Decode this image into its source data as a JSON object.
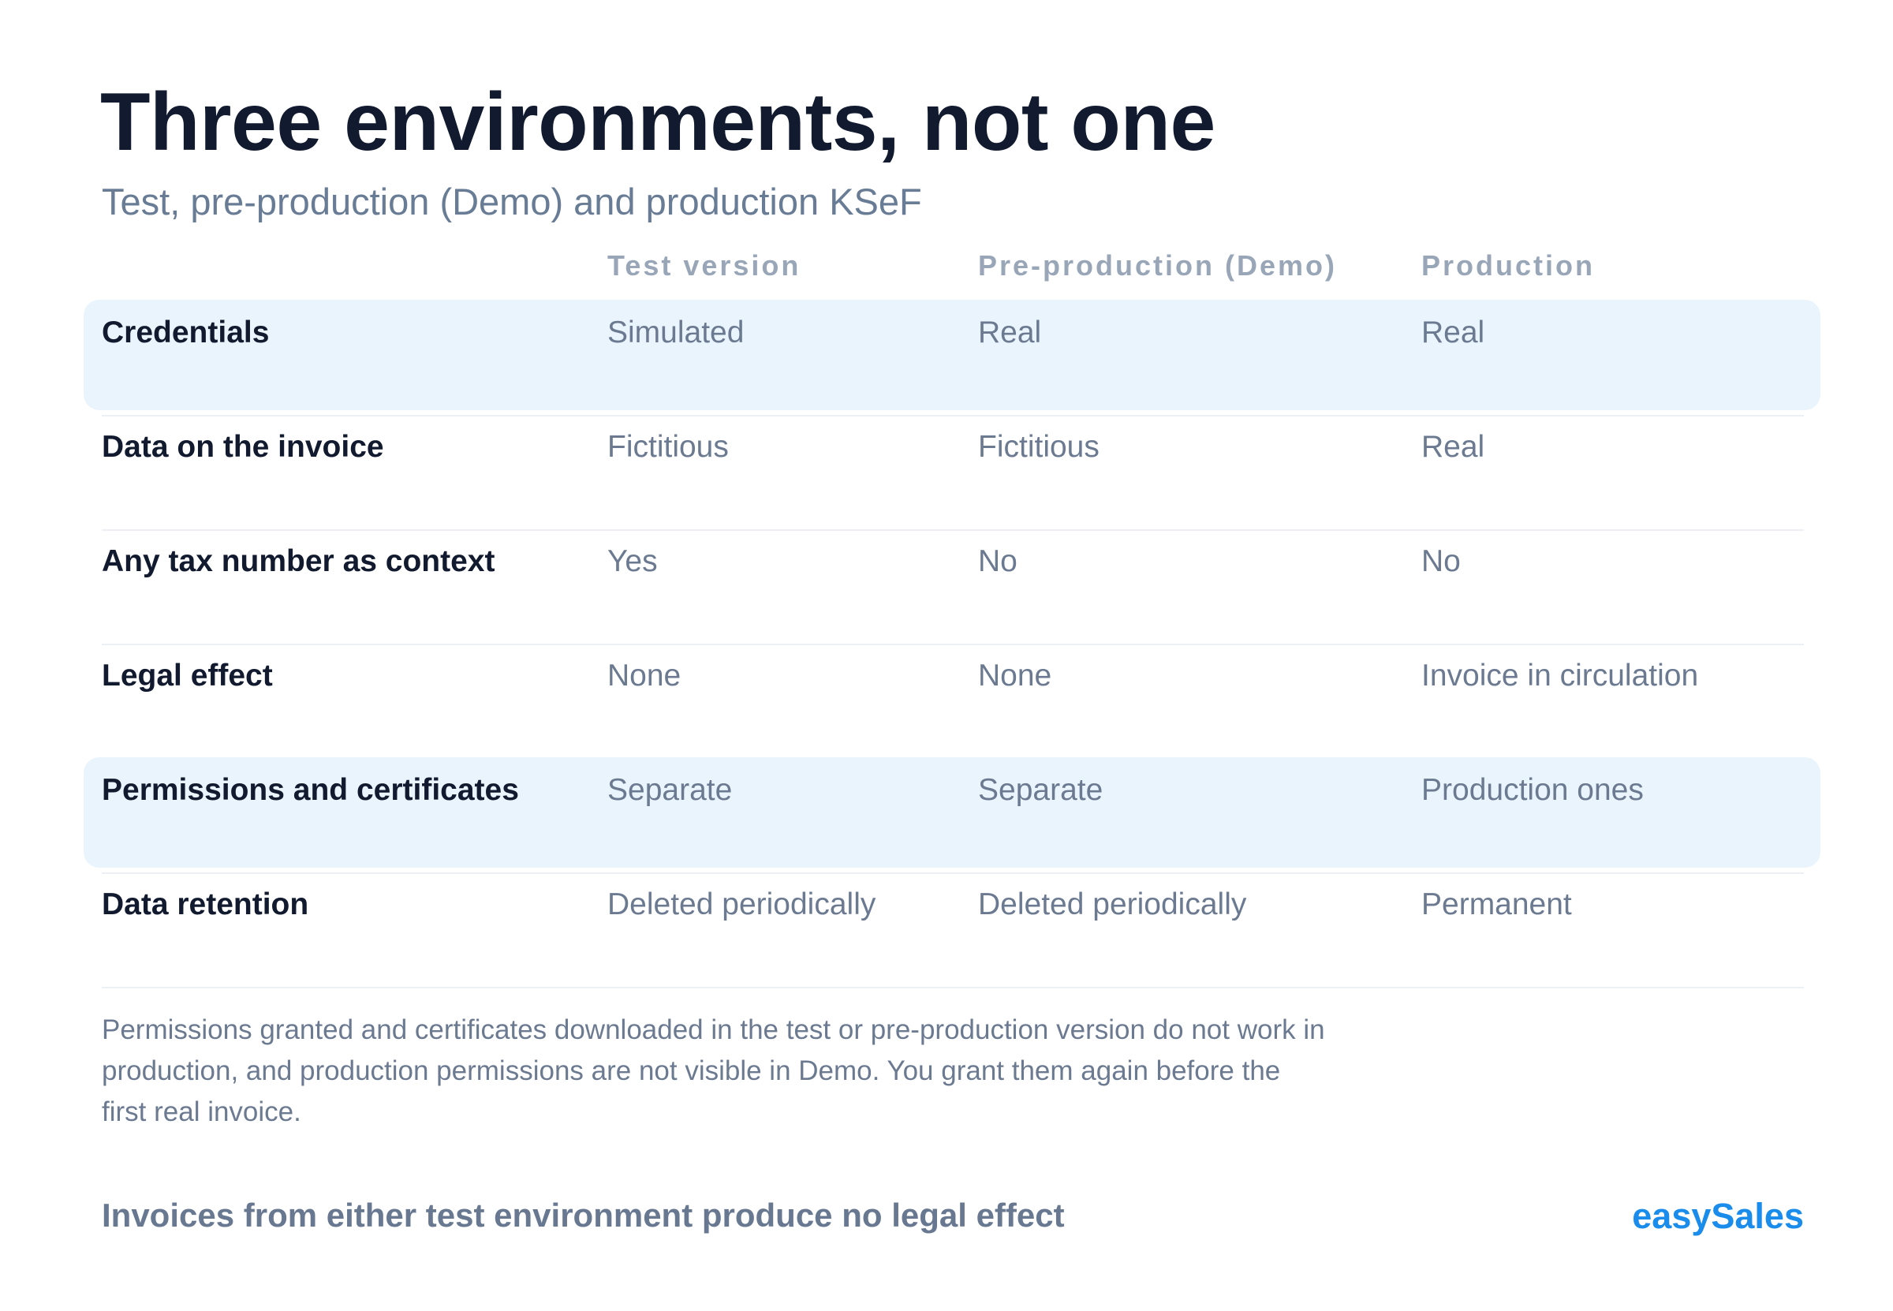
{
  "header": {
    "title": "Three environments, not one",
    "subtitle": "Test, pre-production (Demo) and production KSeF"
  },
  "table": {
    "columns": [
      "Test version",
      "Pre-production (Demo)",
      "Production"
    ],
    "rows": [
      {
        "label": "Credentials",
        "values": [
          "Simulated",
          "Real",
          "Real"
        ],
        "highlighted": true
      },
      {
        "label": "Data on the invoice",
        "values": [
          "Fictitious",
          "Fictitious",
          "Real"
        ],
        "highlighted": false
      },
      {
        "label": "Any tax number as context",
        "values": [
          "Yes",
          "No",
          "No"
        ],
        "highlighted": false
      },
      {
        "label": "Legal effect",
        "values": [
          "None",
          "None",
          "Invoice in circulation"
        ],
        "highlighted": false
      },
      {
        "label": "Permissions and certificates",
        "values": [
          "Separate",
          "Separate",
          "Production ones"
        ],
        "highlighted": true
      },
      {
        "label": "Data retention",
        "values": [
          "Deleted periodically",
          "Deleted periodically",
          "Permanent"
        ],
        "highlighted": false
      }
    ]
  },
  "footnote": "Permissions granted and certificates downloaded in the test or pre-production version do not work in production, and production permissions are not visible in Demo. You grant them again before the first real invoice.",
  "footer": {
    "text": "Invoices from either test environment produce no legal effect",
    "brand": "easySales"
  },
  "colors": {
    "title": "#111a2e",
    "muted": "#6b7a91",
    "highlight_row": "#eaf4fd",
    "brand": "#1a8ceb"
  }
}
